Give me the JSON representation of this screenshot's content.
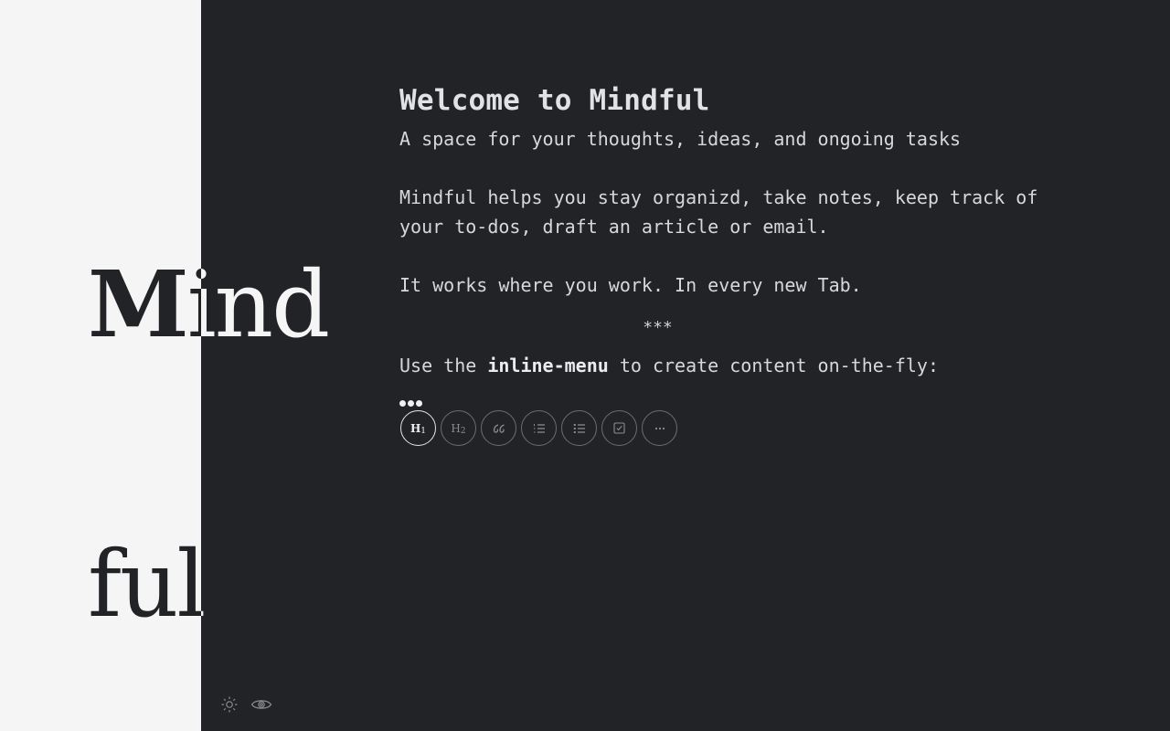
{
  "logo": {
    "line1": "Mind",
    "line2": "ful"
  },
  "content": {
    "title": "Welcome to Mindful",
    "subtitle": "A space for your thoughts, ideas, and ongoing tasks",
    "paragraph1": "Mindful helps you stay organizd, take notes, keep track of your to-dos, draft an article or email.",
    "paragraph2": "It works where you work. In every new Tab.",
    "divider": "***",
    "inline_prefix": "Use the ",
    "inline_bold": "inline-menu",
    "inline_suffix": " to create content on-the-fly:"
  },
  "toolbar": {
    "h1_label": "H",
    "h1_sub": "1",
    "h2_label": "H",
    "h2_sub": "2",
    "icons": [
      "heading-1-icon",
      "heading-2-icon",
      "quote-icon",
      "ordered-list-icon",
      "bullet-list-icon",
      "checkbox-icon",
      "more-icon"
    ]
  },
  "footer": {
    "icons": [
      "sun-icon",
      "eye-icon"
    ]
  },
  "colors": {
    "background": "#222327",
    "panel": "#f5f5f5",
    "text": "#d8d8da"
  }
}
